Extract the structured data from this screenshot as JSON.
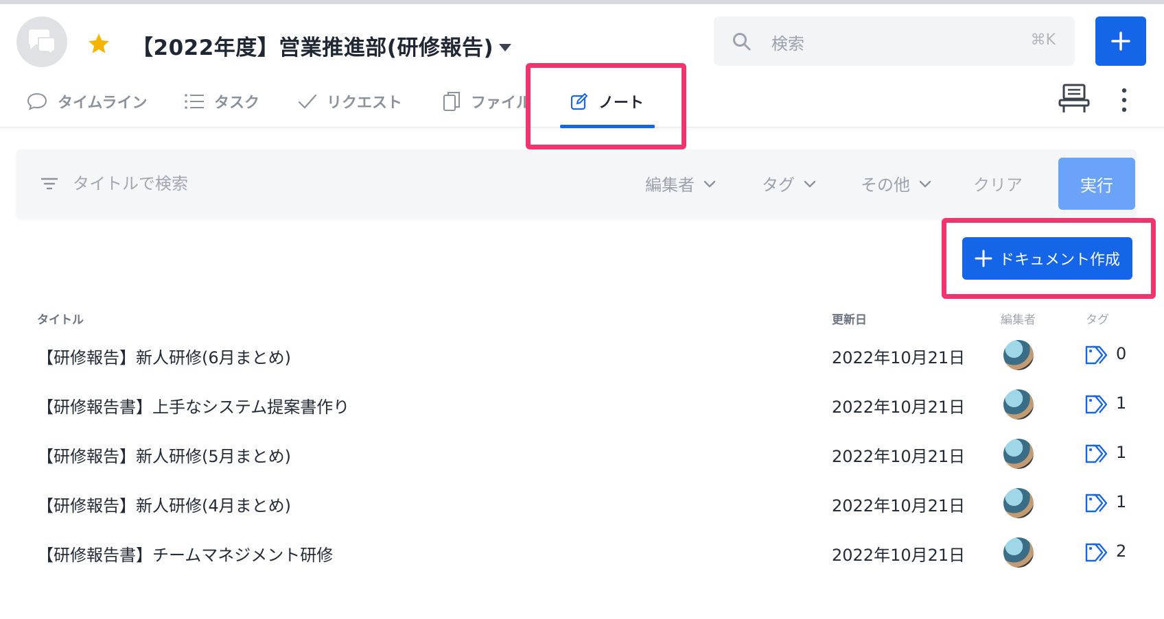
{
  "header": {
    "room_title": "【2022年度】営業推進部(研修報告)",
    "search": {
      "placeholder": "検索",
      "shortcut": "⌘K"
    }
  },
  "tabs": [
    {
      "label": "タイムライン",
      "icon": "chat-bubble-icon",
      "active": false
    },
    {
      "label": "タスク",
      "icon": "list-icon",
      "active": false
    },
    {
      "label": "リクエスト",
      "icon": "check-icon",
      "active": false
    },
    {
      "label": "ファイル",
      "icon": "files-icon",
      "active": false
    },
    {
      "label": "ノート",
      "icon": "edit-note-icon",
      "active": true
    }
  ],
  "filter": {
    "placeholder": "タイトルで検索",
    "editor_label": "編集者",
    "tag_label": "タグ",
    "other_label": "その他",
    "clear_label": "クリア",
    "run_label": "実行"
  },
  "create_button_label": "ドキュメント作成",
  "table": {
    "headers": {
      "title": "タイトル",
      "updated": "更新日",
      "editor": "編集者",
      "tag": "タグ"
    },
    "rows": [
      {
        "title": "【研修報告】新人研修(6月まとめ)",
        "updated": "2022年10月21日",
        "tags": "0"
      },
      {
        "title": "【研修報告書】上手なシステム提案書作り",
        "updated": "2022年10月21日",
        "tags": "1"
      },
      {
        "title": "【研修報告】新人研修(5月まとめ)",
        "updated": "2022年10月21日",
        "tags": "1"
      },
      {
        "title": "【研修報告】新人研修(4月まとめ)",
        "updated": "2022年10月21日",
        "tags": "1"
      },
      {
        "title": "【研修報告書】チームマネジメント研修",
        "updated": "2022年10月21日",
        "tags": "2"
      }
    ]
  },
  "colors": {
    "accent": "#1565e8",
    "run_button": "#6aa3f7",
    "highlight": "#f0346e",
    "star": "#f5b400"
  }
}
